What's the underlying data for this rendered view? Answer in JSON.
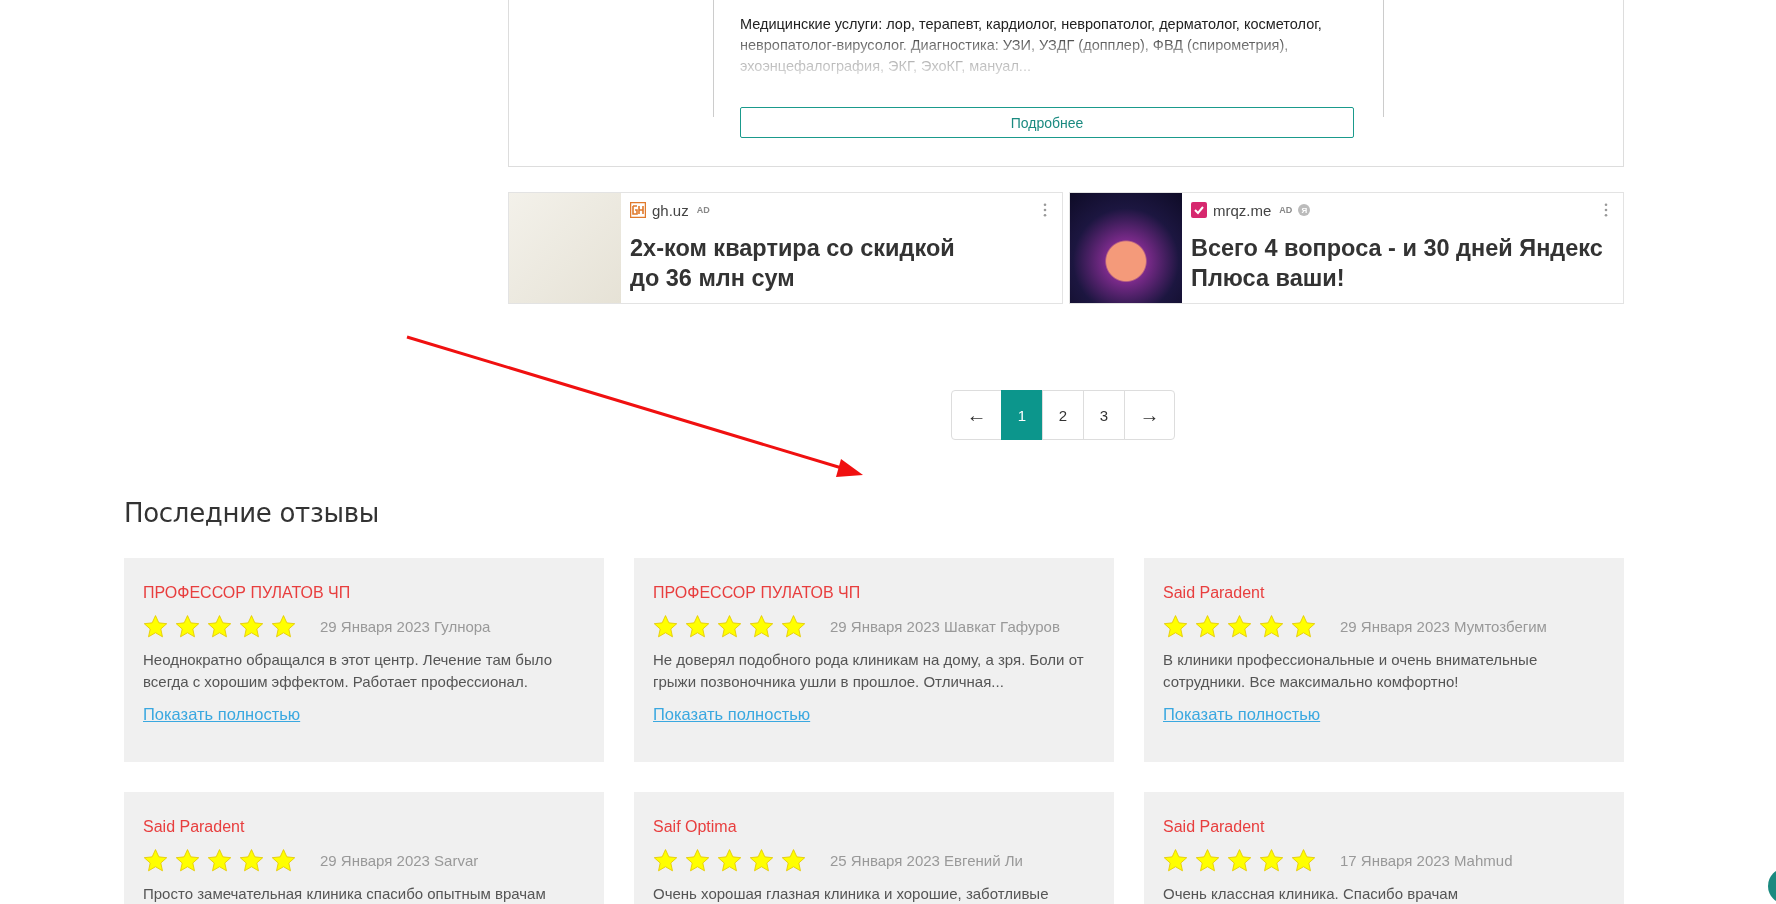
{
  "clinic_card": {
    "description": "Медицинские услуги: лор, терапевт, кардиолог, невропатолог, дерматолог, косметолог, невропатолог-вирусолог. Диагностика: УЗИ, УЗДГ (допплер), ФВД (спирометрия), эхоэнцефалография, ЭКГ, ЭхоКГ, мануал...",
    "button": "Подробнее"
  },
  "ads": [
    {
      "kind": "plan",
      "domain": "gh.uz",
      "badge": "AD",
      "title": "2х-ком квартира со скидкой до 36 млн сум"
    },
    {
      "kind": "promo",
      "domain": "mrqz.me",
      "badge": "AD",
      "title": "Всего 4 вопроса - и 30 дней Яндекс Плюса ваши!",
      "extra_badge": "Я"
    }
  ],
  "pagination": {
    "prev": "←",
    "next": "→",
    "pages": [
      {
        "label": "1",
        "selected": true
      },
      {
        "label": "2",
        "selected": false
      },
      {
        "label": "3",
        "selected": false
      }
    ]
  },
  "reviews_title": "Последние отзывы",
  "reviews": [
    {
      "clinic": "ПРОФЕССОР ПУЛАТОВ ЧП",
      "stars": 5,
      "meta": "29 Января 2023 Гулнора",
      "text": "Неоднократно обращался в этот центр. Лечение там было всегда с хорошим эффектом. Работает профессионал.",
      "link": "Показать полностью"
    },
    {
      "clinic": "ПРОФЕССОР ПУЛАТОВ ЧП",
      "stars": 5,
      "meta": "29 Января 2023 Шавкат Гафуров",
      "text": "Не доверял подобного рода клиникам на дому, а зря. Боли от грыжи позвоночника ушли в прошлое. Отличная...",
      "link": "Показать полностью"
    },
    {
      "clinic": "Said Paradent",
      "stars": 5,
      "meta": "29 Января 2023 Мумтозбегим",
      "text": "В клиники профессиональные и очень внимательные сотрудники. Все максимально комфортно!",
      "link": "Показать полностью"
    },
    {
      "clinic": "Said Paradent",
      "stars": 5,
      "meta": "29 Января 2023 Sarvar",
      "text": "Просто замечательная клиника спасибо опытным врачам"
    },
    {
      "clinic": "Saif Optima",
      "stars": 5,
      "meta": "25 Января 2023 Евгений Ли",
      "text": "Очень хорошая глазная клиника и хорошие, заботливые"
    },
    {
      "clinic": "Said Paradent",
      "stars": 5,
      "meta": "17 Января 2023 Mahmud",
      "text": "Очень классная клиника. Спасибо врачам"
    }
  ]
}
